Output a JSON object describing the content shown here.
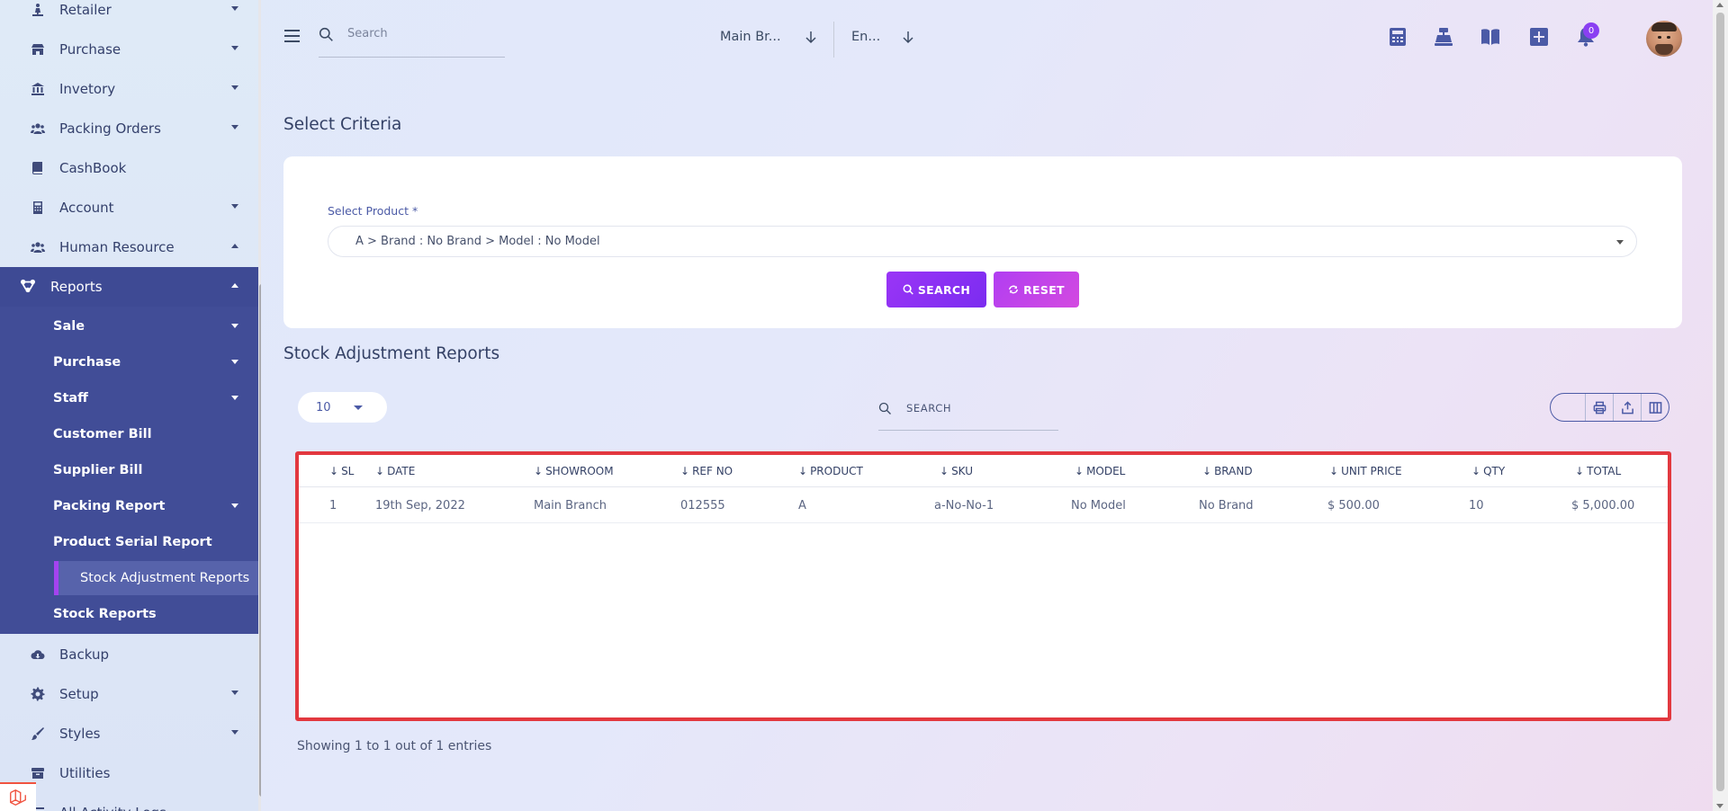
{
  "sidebar": {
    "items_top": [
      {
        "label": "Retailer",
        "icon": "retailer-icon",
        "caret": "down"
      },
      {
        "label": "Purchase",
        "icon": "store-icon",
        "caret": "down"
      },
      {
        "label": "Invetory",
        "icon": "bank-icon",
        "caret": "down"
      },
      {
        "label": "Packing Orders",
        "icon": "users-icon",
        "caret": "down"
      },
      {
        "label": "CashBook",
        "icon": "book-icon",
        "caret": ""
      },
      {
        "label": "Account",
        "icon": "calculator-icon",
        "caret": "down"
      },
      {
        "label": "Human Resource",
        "icon": "users-icon",
        "caret": "up"
      }
    ],
    "reports": {
      "label": "Reports",
      "icon": "network-icon",
      "sub_items": [
        {
          "label": "Sale",
          "caret": true
        },
        {
          "label": "Purchase",
          "caret": true
        },
        {
          "label": "Staff",
          "caret": true
        },
        {
          "label": "Customer Bill",
          "caret": false
        },
        {
          "label": "Supplier Bill",
          "caret": false
        },
        {
          "label": "Packing Report",
          "caret": true
        },
        {
          "label": "Product Serial Report",
          "caret": false
        },
        {
          "label": "Stock Adjustment Reports",
          "caret": false,
          "active": true
        },
        {
          "label": "Stock Reports",
          "caret": false
        }
      ]
    },
    "items_bottom": [
      {
        "label": "Backup",
        "icon": "cloud-download-icon",
        "caret": ""
      },
      {
        "label": "Setup",
        "icon": "gear-icon",
        "caret": "down"
      },
      {
        "label": "Styles",
        "icon": "brush-icon",
        "caret": "down"
      },
      {
        "label": "Utilities",
        "icon": "box-icon",
        "caret": ""
      },
      {
        "label": "All Activity Logs",
        "icon": "list-icon",
        "caret": ""
      }
    ]
  },
  "topbar": {
    "search_placeholder": "Search",
    "branch": "Main Br...",
    "language": "En...",
    "notification_count": "0",
    "icons": [
      "calculator-icon",
      "cash-register-icon",
      "book-open-icon",
      "plus-square-icon",
      "bell-icon"
    ]
  },
  "criteria": {
    "title": "Select Criteria",
    "product_label": "Select Product *",
    "product_value": "A > Brand : No Brand > Model : No Model",
    "search_button": "SEARCH",
    "reset_button": "RESET"
  },
  "report": {
    "title": "Stock Adjustment Reports",
    "per_page": "10",
    "search_placeholder": "SEARCH",
    "columns": [
      "SL",
      "DATE",
      "SHOWROOM",
      "REF NO",
      "PRODUCT",
      "SKU",
      "MODEL",
      "BRAND",
      "UNIT PRICE",
      "QTY",
      "TOTAL"
    ],
    "rows": [
      [
        "1",
        "19th Sep, 2022",
        "Main Branch",
        "012555",
        "A",
        "a-No-No-1",
        "No Model",
        "No Brand",
        "$ 500.00",
        "10",
        "$ 5,000.00"
      ]
    ],
    "footer": "Showing 1 to 1 out of 1 entries"
  },
  "colors": {
    "sidebar_active_bg": "#414d97",
    "accent_purple": "#9a35f6",
    "highlight_border": "#e2383f"
  }
}
